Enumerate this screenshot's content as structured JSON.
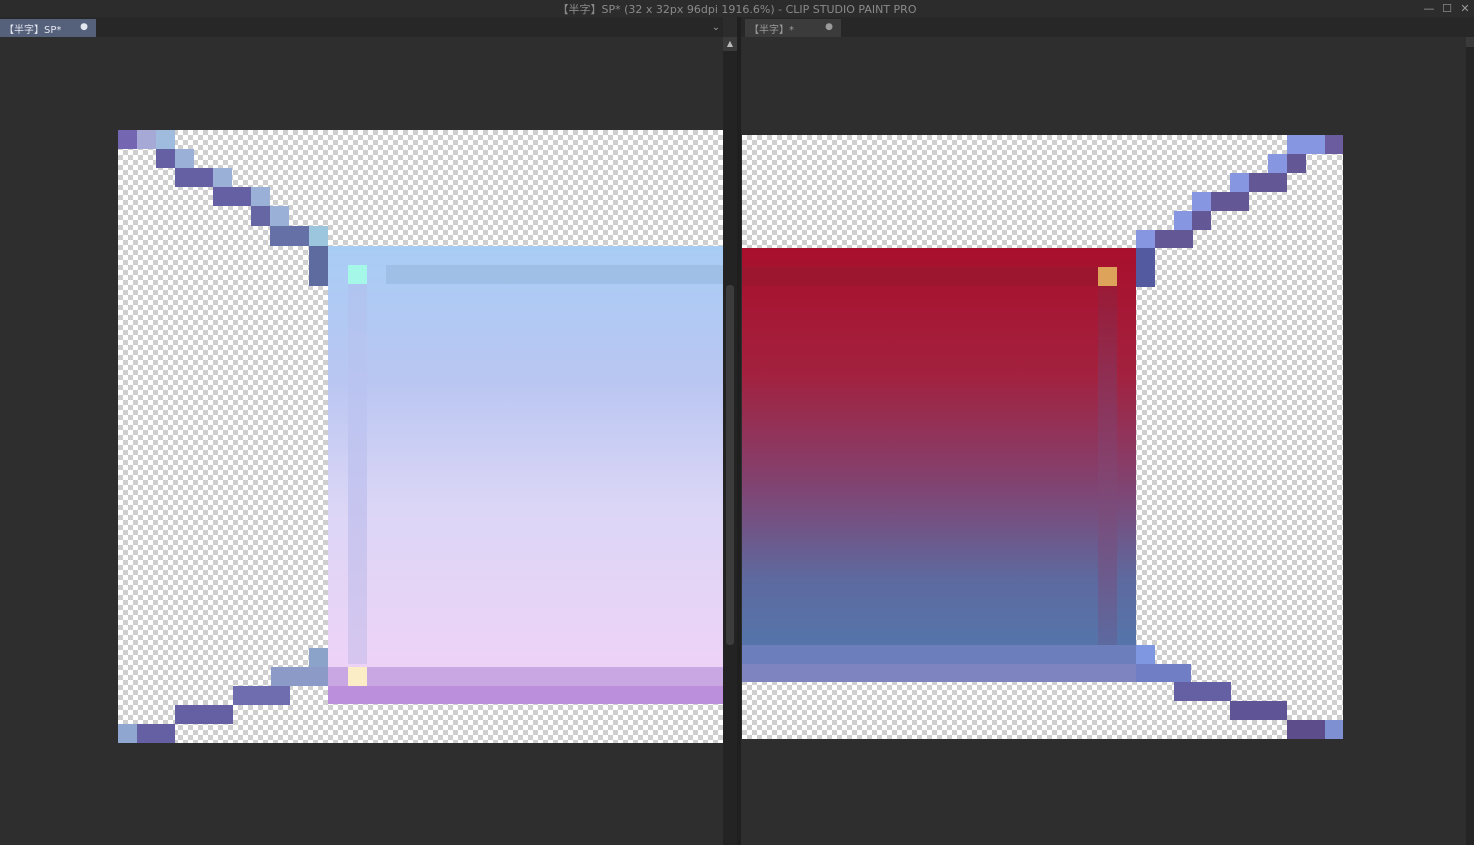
{
  "window": {
    "title": "【半字】SP* (32 x 32px 96dpi 1916.6%)  - CLIP STUDIO PAINT PRO",
    "minimize_icon": "minimize-icon",
    "maximize_icon": "maximize-icon",
    "close_icon": "close-icon"
  },
  "left_pane": {
    "tab_label": "【半字】SP*",
    "tab_close": "●",
    "dropdown": "⌄"
  },
  "right_pane": {
    "tab_label": "【半字】*",
    "tab_close": "●"
  },
  "colors": {
    "left_gradient_top": "#a9cdf4",
    "left_gradient_bottom": "#efd2f7",
    "left_bottom_band": "#bb8fdb",
    "right_gradient_top": "#a80f2c",
    "right_gradient_bottom": "#5378ad",
    "right_bottom_band": "#7e84c0",
    "diagonal_dark": "#6560a3",
    "diagonal_light": "#9bb0d6",
    "corner_cyan": "#a5f8e7",
    "corner_cream": "#fbeec7",
    "corner_gold": "#dea35a",
    "corner_teal": "#1f7a8e"
  }
}
